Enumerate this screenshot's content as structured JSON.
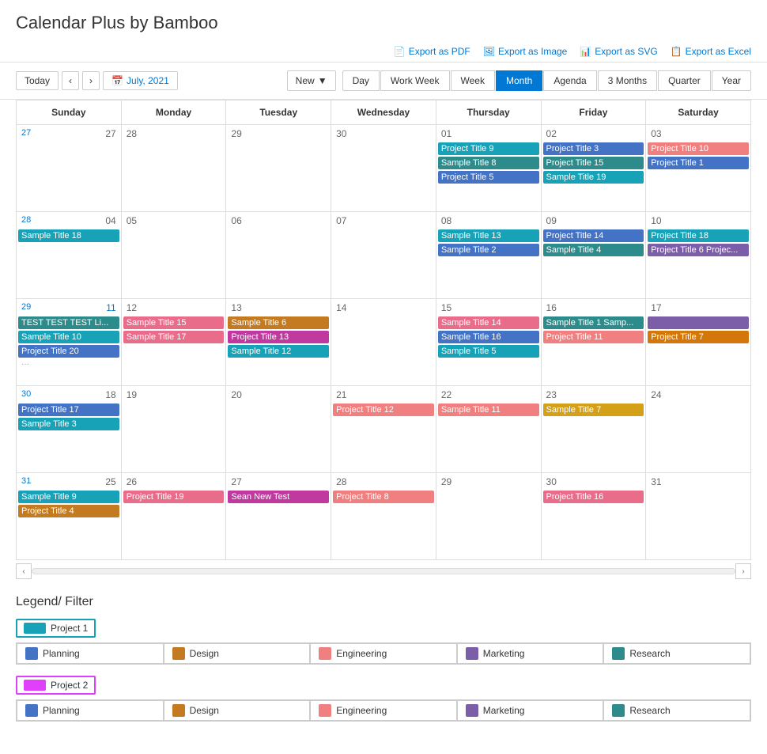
{
  "appTitle": "Calendar Plus by Bamboo",
  "toolbar": {
    "exportPDF": "Export as PDF",
    "exportImage": "Export as Image",
    "exportSVG": "Export as SVG",
    "exportExcel": "Export as Excel"
  },
  "controls": {
    "today": "Today",
    "dateLabel": "July, 2021",
    "newBtn": "New",
    "views": [
      "Day",
      "Work Week",
      "Week",
      "Month",
      "Agenda",
      "3 Months",
      "Quarter",
      "Year"
    ]
  },
  "calendar": {
    "headers": [
      "Sunday",
      "Monday",
      "Tuesday",
      "Wednesday",
      "Thursday",
      "Friday",
      "Saturday"
    ],
    "rows": [
      {
        "week": "27",
        "days": [
          {
            "date": "27",
            "weekNum": "27",
            "events": []
          },
          {
            "date": "28",
            "events": []
          },
          {
            "date": "29",
            "events": []
          },
          {
            "date": "30",
            "events": []
          },
          {
            "date": "01",
            "events": [
              {
                "label": "Project Title 9",
                "color": "ev-cyan"
              },
              {
                "label": "Sample Title 8",
                "color": "ev-teal"
              },
              {
                "label": "Project Title 5",
                "color": "ev-blue"
              }
            ]
          },
          {
            "date": "02",
            "events": [
              {
                "label": "Project Title 3",
                "color": "ev-blue"
              },
              {
                "label": "Project Title 15",
                "color": "ev-teal"
              },
              {
                "label": "Sample Title 19",
                "color": "ev-cyan"
              }
            ]
          },
          {
            "date": "03",
            "events": [
              {
                "label": "Project Title 10",
                "color": "ev-salmon"
              },
              {
                "label": "Project Title 1",
                "color": "ev-blue"
              }
            ]
          }
        ]
      },
      {
        "week": "28",
        "days": [
          {
            "date": "04",
            "weekNum": "28",
            "events": [
              {
                "label": "Sample Title 18",
                "color": "ev-cyan"
              }
            ]
          },
          {
            "date": "05",
            "events": []
          },
          {
            "date": "06",
            "events": []
          },
          {
            "date": "07",
            "events": []
          },
          {
            "date": "08",
            "events": [
              {
                "label": "Sample Title 13",
                "color": "ev-cyan"
              },
              {
                "label": "Sample Title 2",
                "color": "ev-blue"
              }
            ]
          },
          {
            "date": "09",
            "events": [
              {
                "label": "Project Title 14",
                "color": "ev-blue"
              },
              {
                "label": "Sample Title 4",
                "color": "ev-teal"
              }
            ]
          },
          {
            "date": "10",
            "events": [
              {
                "label": "Project Title 18",
                "color": "ev-cyan"
              },
              {
                "label": "Project Title 6 Projec...",
                "color": "ev-purple"
              }
            ]
          }
        ]
      },
      {
        "week": "29",
        "days": [
          {
            "date": "11",
            "weekNum": "29",
            "weekNumBlue": true,
            "events": [
              {
                "label": "TEST TEST TEST Li...",
                "color": "ev-teal"
              },
              {
                "label": "Sample Title 10",
                "color": "ev-cyan"
              },
              {
                "label": "Project Title 20",
                "color": "ev-blue"
              }
            ]
          },
          {
            "date": "12",
            "events": [
              {
                "label": "Sample Title 15",
                "color": "ev-pink"
              },
              {
                "label": "Sample Title 17",
                "color": "ev-pink"
              }
            ]
          },
          {
            "date": "13",
            "events": [
              {
                "label": "Sample Title 6",
                "color": "ev-orange"
              },
              {
                "label": "Project Title 13",
                "color": "ev-magenta"
              },
              {
                "label": "Sample Title 12",
                "color": "ev-cyan"
              }
            ]
          },
          {
            "date": "14",
            "events": []
          },
          {
            "date": "15",
            "events": [
              {
                "label": "Sample Title 14",
                "color": "ev-pink"
              },
              {
                "label": "Sample Title 16",
                "color": "ev-blue"
              },
              {
                "label": "Sample Title 5",
                "color": "ev-cyan"
              }
            ]
          },
          {
            "date": "16",
            "events": [
              {
                "label": "Sample Title 1 Samp...",
                "color": "ev-teal"
              },
              {
                "label": "Project Title 11",
                "color": "ev-salmon"
              }
            ]
          },
          {
            "date": "17",
            "events": [
              {
                "label": "",
                "color": "ev-purple"
              },
              {
                "label": "Project Title 7",
                "color": "ev-dark-orange"
              }
            ]
          }
        ]
      },
      {
        "week": "30",
        "days": [
          {
            "date": "18",
            "weekNum": "30",
            "events": [
              {
                "label": "Project Title 17",
                "color": "ev-blue"
              },
              {
                "label": "Sample Title 3",
                "color": "ev-cyan"
              }
            ]
          },
          {
            "date": "19",
            "events": []
          },
          {
            "date": "20",
            "events": []
          },
          {
            "date": "21",
            "events": [
              {
                "label": "Project Title 12",
                "color": "ev-salmon"
              }
            ]
          },
          {
            "date": "22",
            "events": [
              {
                "label": "Sample Title 11",
                "color": "ev-salmon"
              }
            ]
          },
          {
            "date": "23",
            "events": [
              {
                "label": "Sample Title 7",
                "color": "ev-gold"
              }
            ]
          },
          {
            "date": "24",
            "events": []
          }
        ]
      },
      {
        "week": "31",
        "days": [
          {
            "date": "25",
            "weekNum": "31",
            "events": [
              {
                "label": "Sample Title 9",
                "color": "ev-cyan"
              },
              {
                "label": "Project Title 4",
                "color": "ev-orange"
              }
            ]
          },
          {
            "date": "26",
            "events": [
              {
                "label": "Project Title 19",
                "color": "ev-pink"
              }
            ]
          },
          {
            "date": "27",
            "events": [
              {
                "label": "Sean New Test",
                "color": "ev-magenta"
              }
            ]
          },
          {
            "date": "28",
            "events": [
              {
                "label": "Project Title 8",
                "color": "ev-salmon"
              }
            ]
          },
          {
            "date": "29",
            "events": []
          },
          {
            "date": "30",
            "events": [
              {
                "label": "Project Title 16",
                "color": "ev-pink"
              }
            ]
          },
          {
            "date": "31",
            "events": []
          }
        ]
      }
    ]
  },
  "legend": {
    "title": "Legend/ Filter",
    "project1": {
      "label": "Project 1",
      "color": "#17a2b8",
      "categories": [
        {
          "label": "Planning",
          "color": "#4472c4"
        },
        {
          "label": "Design",
          "color": "#c47a20"
        },
        {
          "label": "Engineering",
          "color": "#f08080"
        },
        {
          "label": "Marketing",
          "color": "#7b5ea7"
        },
        {
          "label": "Research",
          "color": "#2e8b8b"
        }
      ]
    },
    "project2": {
      "label": "Project 2",
      "color": "#e040fb",
      "categories": [
        {
          "label": "Planning",
          "color": "#4472c4"
        },
        {
          "label": "Design",
          "color": "#c47a20"
        },
        {
          "label": "Engineering",
          "color": "#f08080"
        },
        {
          "label": "Marketing",
          "color": "#7b5ea7"
        },
        {
          "label": "Research",
          "color": "#2e8b8b"
        }
      ]
    }
  }
}
